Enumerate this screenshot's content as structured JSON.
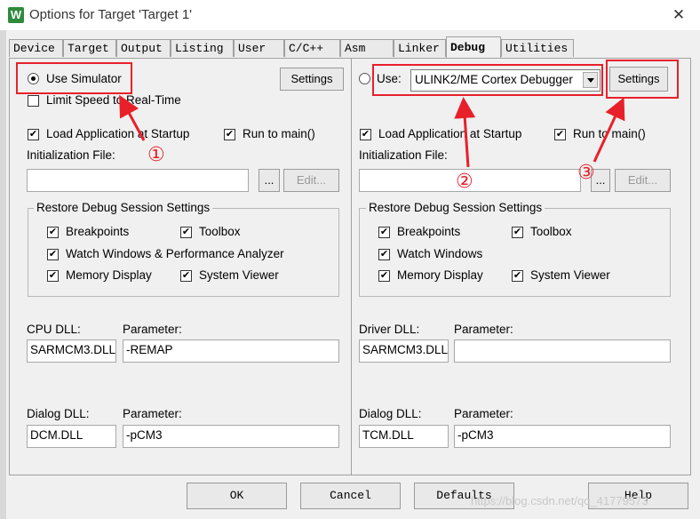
{
  "window": {
    "title": "Options for Target 'Target 1'",
    "close_glyph": "✕",
    "icon_letter": "W"
  },
  "tabs": [
    "Device",
    "Target",
    "Output",
    "Listing",
    "User",
    "C/C++",
    "Asm",
    "Linker",
    "Debug",
    "Utilities"
  ],
  "active_tab": "Debug",
  "left": {
    "use_simulator": "Use Simulator",
    "limit_speed": "Limit Speed to Real-Time",
    "settings_button": "Settings",
    "load_app": "Load Application at Startup",
    "run_to_main": "Run to main()",
    "init_file_label": "Initialization File:",
    "browse_button": "...",
    "edit_button": "Edit...",
    "restore_group": "Restore Debug Session Settings",
    "breakpoints": "Breakpoints",
    "toolbox": "Toolbox",
    "watch_windows": "Watch Windows & Performance Analyzer",
    "memory_display": "Memory Display",
    "system_viewer": "System Viewer",
    "cpu_dll_label": "CPU DLL:",
    "cpu_dll_value": "SARMCM3.DLL",
    "parameter_label": "Parameter:",
    "cpu_param_value": "-REMAP",
    "dialog_dll_label": "Dialog DLL:",
    "dialog_dll_value": "DCM.DLL",
    "dialog_param_value": "-pCM3"
  },
  "right": {
    "use_label": "Use:",
    "debugger_selected": "ULINK2/ME Cortex Debugger",
    "settings_button": "Settings",
    "load_app": "Load Application at Startup",
    "run_to_main": "Run to main()",
    "init_file_label": "Initialization File:",
    "browse_button": "...",
    "edit_button": "Edit...",
    "restore_group": "Restore Debug Session Settings",
    "breakpoints": "Breakpoints",
    "toolbox": "Toolbox",
    "watch_windows": "Watch Windows",
    "memory_display": "Memory Display",
    "system_viewer": "System Viewer",
    "driver_dll_label": "Driver DLL:",
    "driver_dll_value": "SARMCM3.DLL",
    "parameter_label": "Parameter:",
    "driver_param_value": "",
    "dialog_dll_label": "Dialog DLL:",
    "dialog_dll_value": "TCM.DLL",
    "dialog_param_value": "-pCM3"
  },
  "footer": {
    "ok": "OK",
    "cancel": "Cancel",
    "defaults": "Defaults",
    "help": "Help"
  },
  "annotations": {
    "one": "①",
    "two": "②",
    "three": "③"
  },
  "watermark": "https://blog.csdn.net/qq_41779573",
  "colors": {
    "annotation": "#e8202a",
    "icon": "#2e8b3a"
  }
}
